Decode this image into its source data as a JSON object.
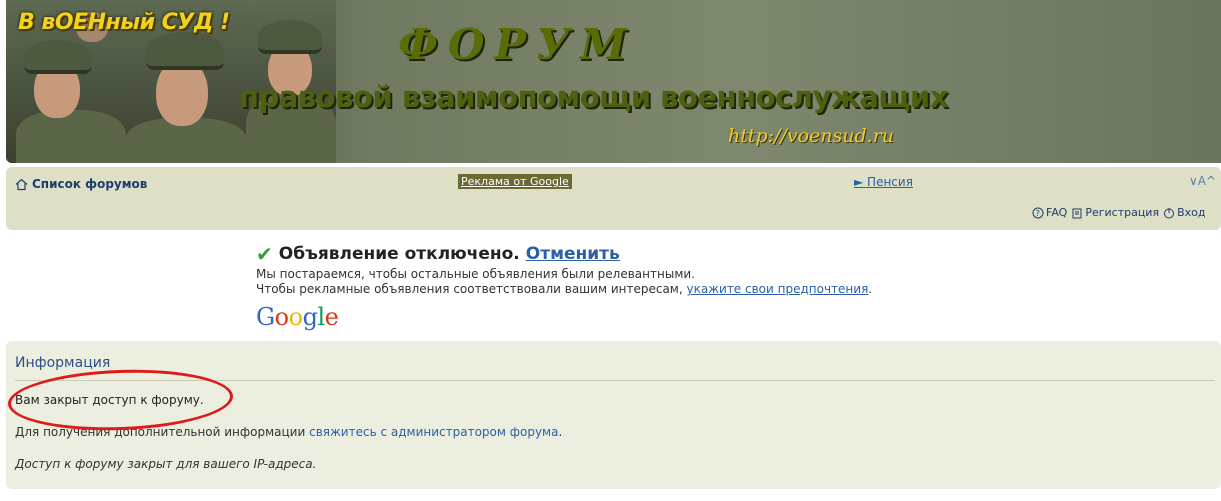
{
  "banner": {
    "title_small": "В вОЕНный СУД !",
    "title_forum": "ФОРУМ",
    "title_sub": "правовой взаимопомощи военнослужащих",
    "url": "http://voensud.ru"
  },
  "nav": {
    "home": "Список форумов",
    "ad_label": "Реклама от Google",
    "pension": "► Пенсия",
    "fontsize": "∨A^",
    "faq": "FAQ",
    "register": "Регистрация",
    "login": "Вход"
  },
  "notice": {
    "headline": "Объявление отключено.",
    "cancel": "Отменить",
    "line1": "Мы постараемся, чтобы остальные объявления были релевантными.",
    "line2_prefix": "Чтобы рекламные объявления соответствовали вашим интересам,",
    "line2_link": "укажите свои предпочтения",
    "line2_suffix": ".",
    "google": [
      "G",
      "o",
      "o",
      "g",
      "l",
      "e"
    ]
  },
  "panel": {
    "title": "Информация",
    "message": "Вам закрыт доступ к форуму.",
    "more_prefix": "Для получения дополнительной информации",
    "more_link": "свяжитесь с администратором форума",
    "more_suffix": ".",
    "ip_note": "Доступ к форуму закрыт для вашего IP-адреса."
  },
  "colors": {
    "accent_link": "#2c5fa6",
    "nav_bg": "#dddfc6",
    "panel_bg": "#eceedf",
    "highlight": "#e01a1a"
  }
}
